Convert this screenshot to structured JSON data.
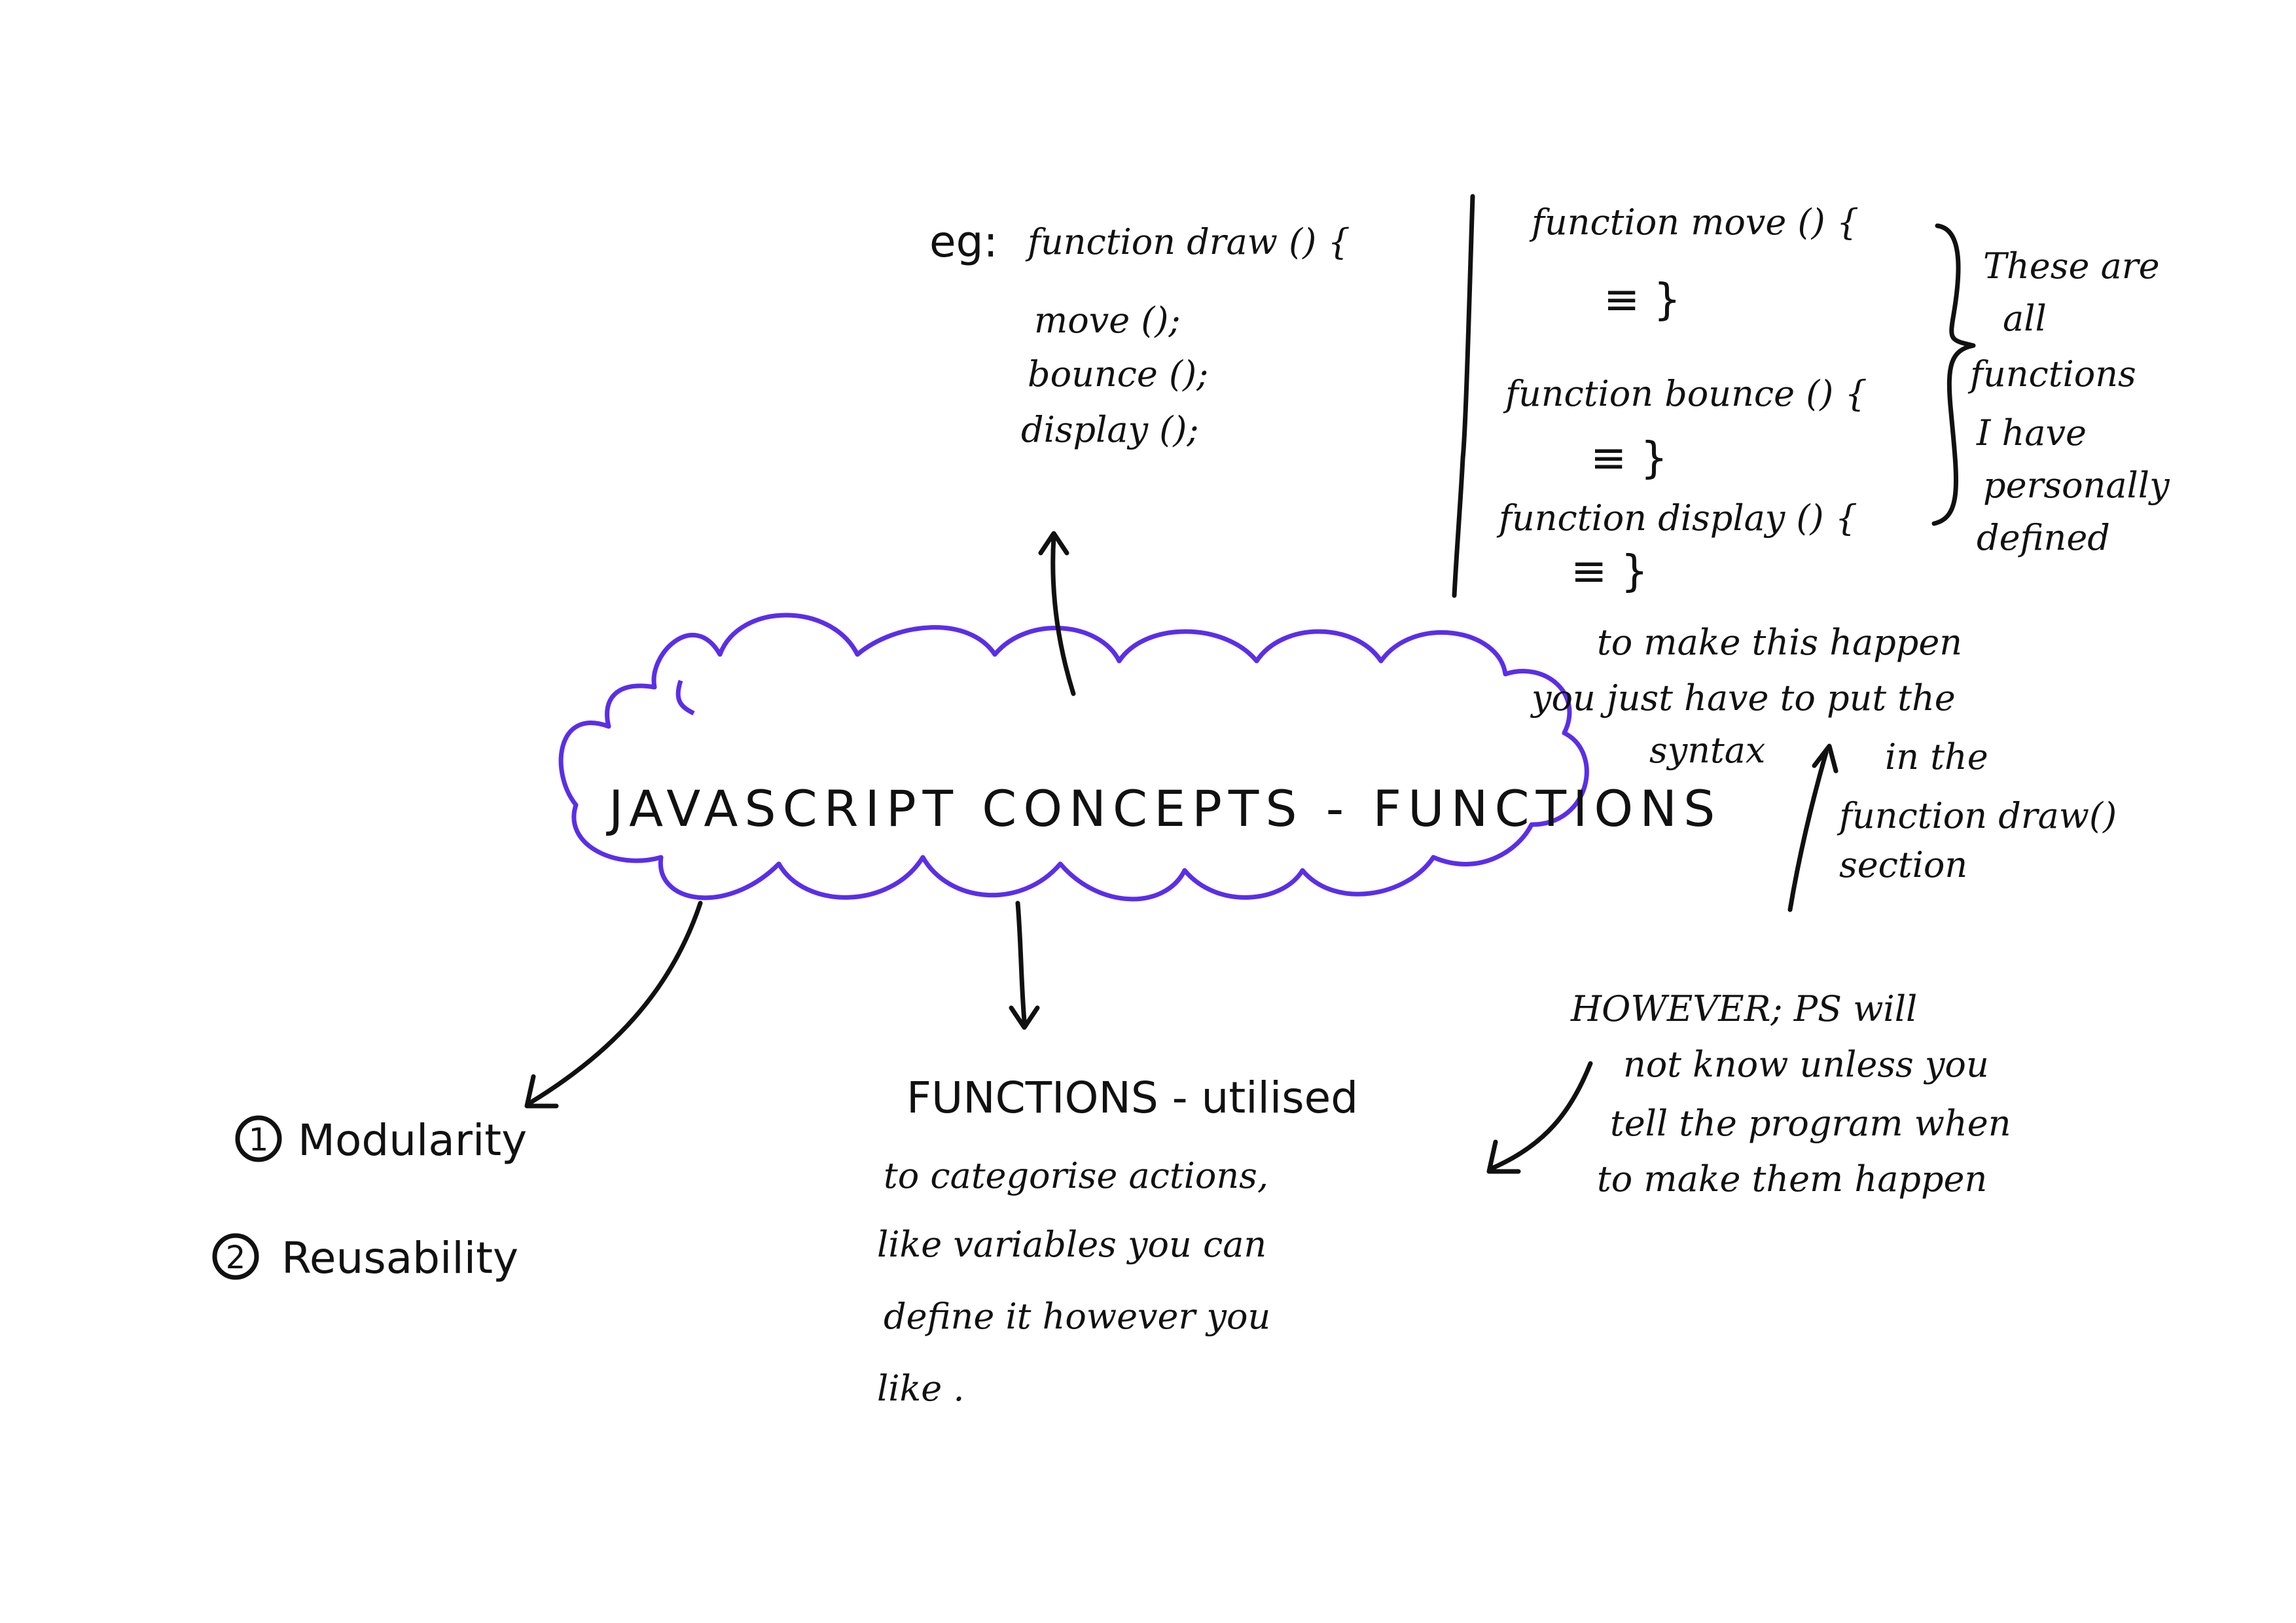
{
  "colors": {
    "ink": "#111111",
    "cloud": "#5b2ee8",
    "background": "#ffffff"
  },
  "title": "JAVASCRIPT CONCEPTS - FUNCTIONS",
  "example": {
    "prefix": "eg:",
    "header": "function draw () {",
    "calls": [
      "move ();",
      "bounce ();",
      "display ();"
    ]
  },
  "definitions": [
    {
      "header": "function move () {",
      "body": "≡ }"
    },
    {
      "header": "function bounce () {",
      "body": "≡ }"
    },
    {
      "header": "function display () {",
      "body": "≡ }"
    }
  ],
  "brace_note": [
    "These are",
    "all",
    "functions",
    "I have",
    "personally",
    "defined"
  ],
  "syntax_note_left": [
    "to make this happen",
    "you just have to put the",
    "syntax"
  ],
  "syntax_note_right": [
    "in the",
    "function draw()",
    "section"
  ],
  "however_note": [
    "HOWEVER; PS will",
    "not know unless you",
    "tell the program when",
    "to make them happen"
  ],
  "functions_note": [
    "FUNCTIONS - utilised",
    "to categorise actions,",
    "like variables you can",
    "define it however you",
    "like ."
  ],
  "benefits": [
    {
      "number": "1",
      "label": "Modularity"
    },
    {
      "number": "2",
      "label": "Reusability"
    }
  ]
}
